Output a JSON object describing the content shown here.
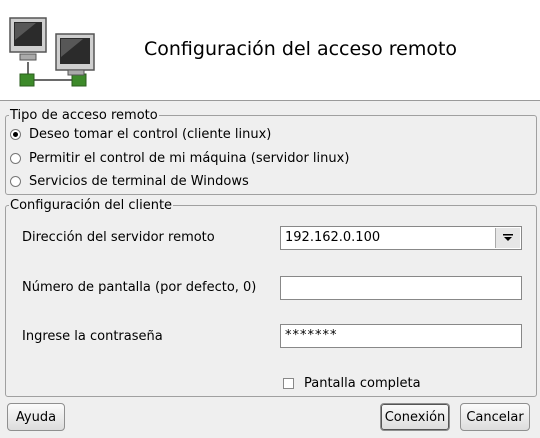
{
  "header": {
    "title": "Configuración del acceso remoto",
    "icon": "network-computers-icon"
  },
  "access_type": {
    "group_title": "Tipo de acceso remoto",
    "options": [
      {
        "label": "Deseo tomar el control (cliente linux)",
        "checked": true
      },
      {
        "label": "Permitir el control de mi máquina (servidor linux)",
        "checked": false
      },
      {
        "label": "Servicios de terminal de Windows",
        "checked": false
      }
    ]
  },
  "client_config": {
    "group_title": "Configuración del cliente",
    "server_label": "Dirección del servidor remoto",
    "server_value": "192.162.0.100",
    "screen_label": "Número de pantalla (por defecto, 0)",
    "screen_value": "",
    "password_label": "Ingrese la contraseña",
    "password_value": "*******",
    "fullscreen_label": "Pantalla completa",
    "fullscreen_checked": false
  },
  "buttons": {
    "help": "Ayuda",
    "connect": "Conexión",
    "cancel": "Cancelar"
  }
}
